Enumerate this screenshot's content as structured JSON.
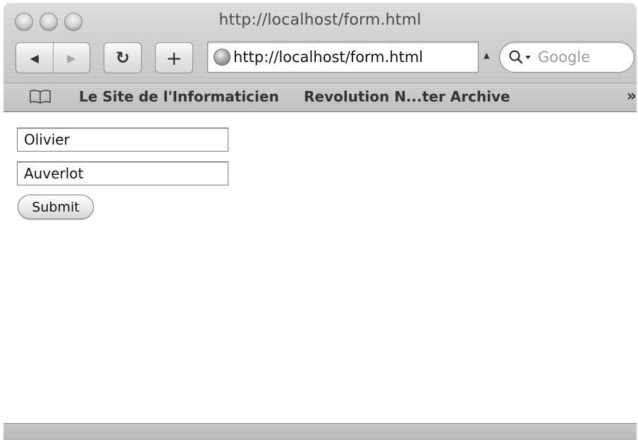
{
  "window": {
    "title": "http://localhost/form.html"
  },
  "toolbar": {
    "back_icon": "back-arrow-icon",
    "forward_icon": "forward-arrow-icon",
    "reload_icon": "reload-icon",
    "add_icon": "plus-icon",
    "reload_glyph": "↻",
    "add_glyph": "+",
    "back_glyph": "◀",
    "forward_glyph": "▶"
  },
  "address_bar": {
    "url": "http://localhost/form.html"
  },
  "search": {
    "placeholder": "Google"
  },
  "bookmarks_bar": {
    "items": [
      {
        "label": "Le Site de l'Informaticien"
      },
      {
        "label": "Revolution N...ter Archive"
      }
    ],
    "more_glyph": "»"
  },
  "form": {
    "first_field_value": "Olivier",
    "second_field_value": "Auverlot",
    "submit_label": "Submit"
  }
}
